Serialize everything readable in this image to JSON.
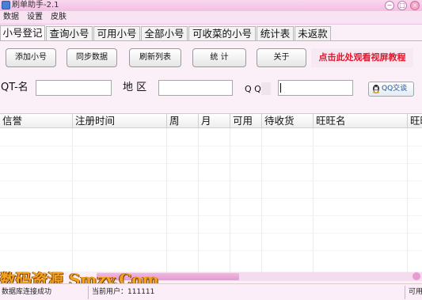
{
  "window": {
    "title": "刷单助手-2.1",
    "controls": [
      "minimize",
      "maximize",
      "close"
    ]
  },
  "menu": [
    "数据",
    "设置",
    "皮肤"
  ],
  "tabs": [
    "小号登记",
    "查询小号",
    "可用小号",
    "全部小号",
    "可收菜的小号",
    "统计表",
    "未返款"
  ],
  "active_tab": "小号登记",
  "toolbar": {
    "add_account": "添加小号",
    "sync_data": "同步数据",
    "refresh_list": "刷新列表",
    "statistics": "统 计",
    "about": "关于",
    "tutorial_link": "点击此处观看视屏教程"
  },
  "form": {
    "qt_name_label": "QT-名",
    "qt_name_value": "",
    "region_label": "地 区",
    "region_value": "",
    "qq_label": "Q Q",
    "qq_value": "",
    "qq_chat_button": "QQ交谈"
  },
  "table": {
    "columns": [
      "信誉",
      "注册时间",
      "周",
      "月",
      "可用",
      "待收货",
      "旺旺名",
      "旺旺"
    ],
    "rows": []
  },
  "watermark": "数码资源 Smzy.Com",
  "status": {
    "db": "数据库连接成功",
    "user_label": "当前用户：",
    "user_id": "111111",
    "right": "可用"
  },
  "colors": {
    "title_bar": "#f2bfe4",
    "window_bg": "#fbeff8",
    "promo_text": "#e0182e",
    "watermark": "#f2a21d"
  }
}
